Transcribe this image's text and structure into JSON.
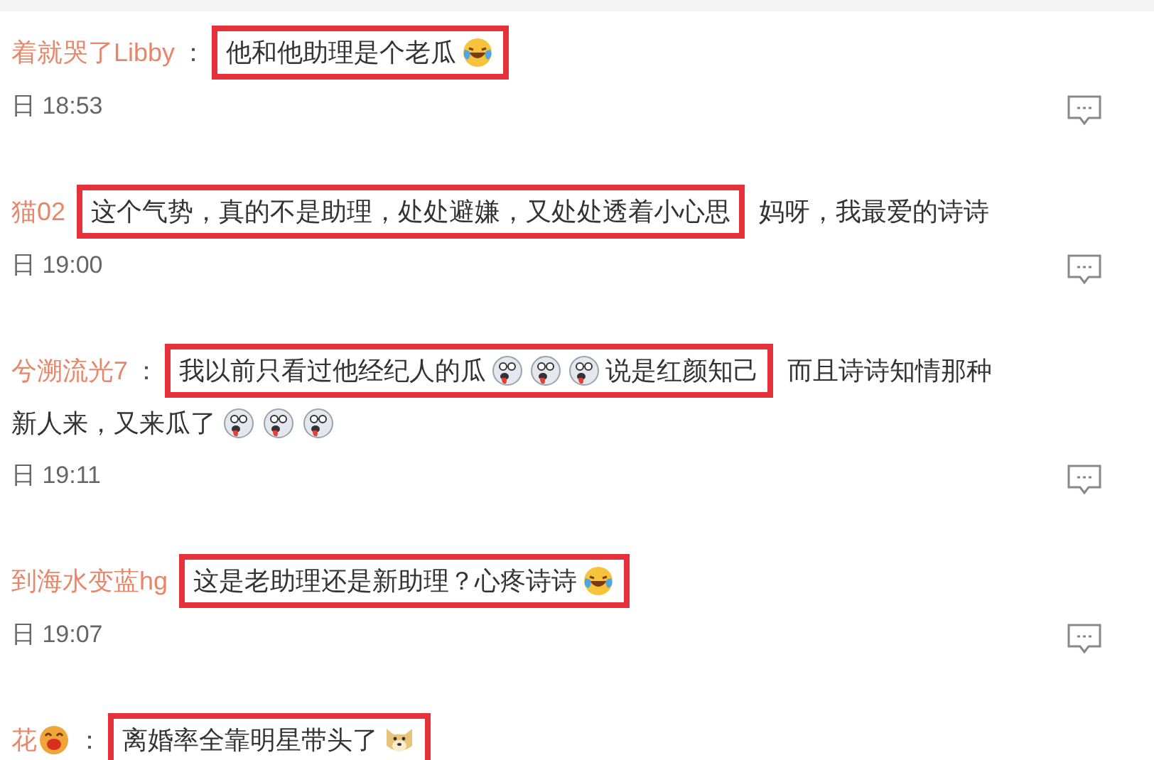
{
  "comments": [
    {
      "name": [
        {
          "kind": "text",
          "text": "着就哭了Libby"
        }
      ],
      "separator": "：",
      "highlight": [
        {
          "kind": "text",
          "text": "他和他助理是个老瓜"
        },
        {
          "kind": "laughing"
        }
      ],
      "time": "日 18:53"
    },
    {
      "name": [
        {
          "kind": "text",
          "text": "猫02"
        }
      ],
      "highlight": [
        {
          "kind": "text",
          "text": "这个气势，真的不是助理，处处避嫌，又处处透着小心思"
        }
      ],
      "after": "妈呀，我最爱的诗诗",
      "time": "日 19:00"
    },
    {
      "name": [
        {
          "kind": "text",
          "text": "兮溯流光7"
        }
      ],
      "separator": "：",
      "highlight": [
        {
          "kind": "text",
          "text": "我以前只看过他经纪人的瓜"
        },
        {
          "kind": "shocked"
        },
        {
          "kind": "shocked"
        },
        {
          "kind": "shocked"
        },
        {
          "kind": "text",
          "text": "说是红颜知己"
        }
      ],
      "after": "而且诗诗知情那种",
      "line2": [
        {
          "kind": "text",
          "text": "新人来，又来瓜了"
        },
        {
          "kind": "shocked"
        },
        {
          "kind": "shocked"
        },
        {
          "kind": "shocked"
        }
      ],
      "time": "日 19:11"
    },
    {
      "name": [
        {
          "kind": "text",
          "text": "到海水变蓝hg"
        }
      ],
      "highlight": [
        {
          "kind": "text",
          "text": "这是老助理还是新助理？心疼诗诗"
        },
        {
          "kind": "laughing"
        }
      ],
      "time": "日 19:07"
    },
    {
      "name": [
        {
          "kind": "text",
          "text": "花"
        },
        {
          "kind": "blush"
        }
      ],
      "separator": "：",
      "highlight": [
        {
          "kind": "text",
          "text": "离婚率全靠明星带头了"
        },
        {
          "kind": "doge"
        }
      ]
    }
  ]
}
